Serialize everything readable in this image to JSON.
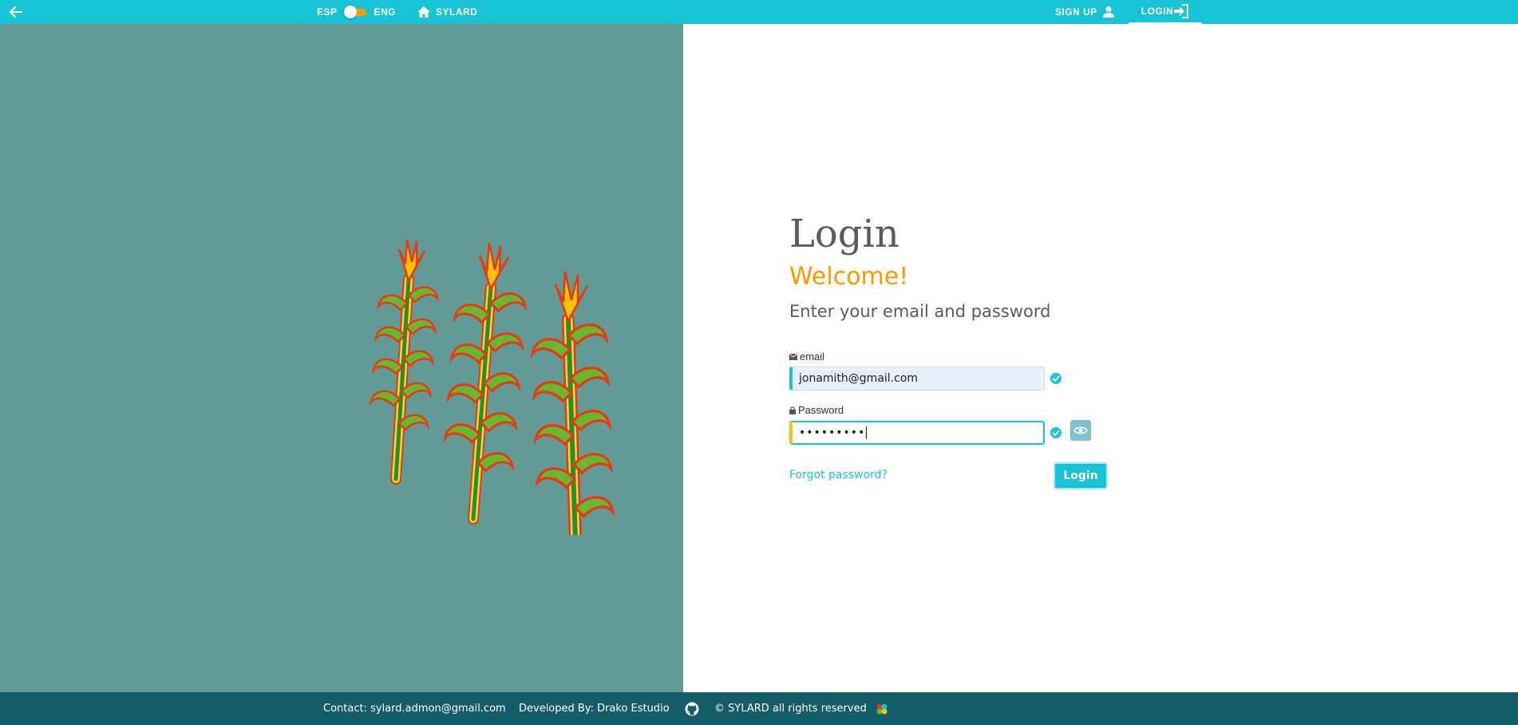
{
  "colors": {
    "topbar": "#19c3d6",
    "left_panel": "#639a96",
    "footer": "#145c68",
    "accent": "#ff9800",
    "primary": "#19c3d6"
  },
  "header": {
    "back_icon": "arrow-left-icon",
    "lang_left": "ESP",
    "lang_right": "ENG",
    "home_label": "SYLARD",
    "signup_label": "SIGN UP",
    "login_label": "LOGIN"
  },
  "illustration": {
    "icon": "corn-plants-icon"
  },
  "form": {
    "title": "Login",
    "welcome": "Welcome!",
    "subtitle": "Enter your email and password",
    "email_label": "email",
    "email_value": "jonamith@gmail.com",
    "password_label": "Password",
    "password_value": "•••••••••",
    "forgot_label": "Forgot password?",
    "login_button": "Login"
  },
  "footer": {
    "contact": "Contact: sylard.admon@gmail.com",
    "developed": "Developed By: Drako Estudio",
    "rights": "© SYLARD all rights reserved"
  }
}
